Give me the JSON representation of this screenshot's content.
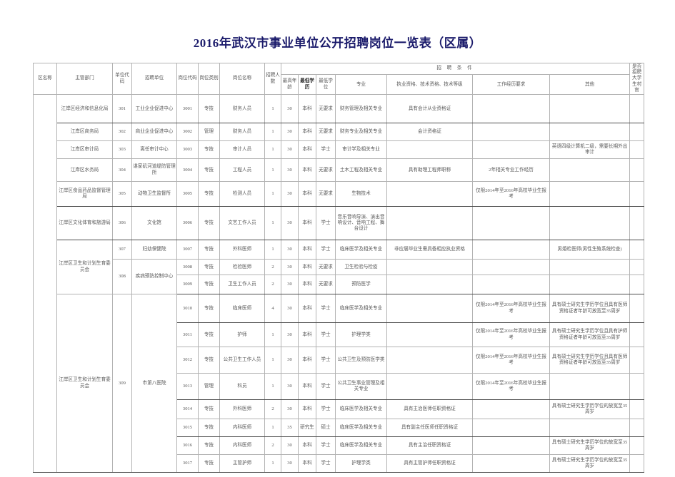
{
  "title": "2016年武汉市事业单位公开招聘岗位一览表（区属）",
  "header": {
    "group_label": "招 聘 条 件",
    "columns": {
      "region": "区名称",
      "dept": "主管部门",
      "unit_code": "单位代码",
      "unit": "招聘单位",
      "post_code": "岗位代码",
      "post_type": "岗位类别",
      "post_name": "岗位名称",
      "headcount": "招聘人数",
      "max_age": "最高年龄",
      "min_edu": "最低学历",
      "min_degree": "最低学位",
      "major": "专业",
      "qualification": "执业资格、技术资格、技术等级",
      "experience": "工作经历要求",
      "other": "其他",
      "village_official": "是否招聘大学生村官"
    }
  },
  "rows": [
    {
      "region": "",
      "dept": "江岸区经济和信息化局",
      "unit_code": "301",
      "unit": "工业企业促进中心",
      "post_code": "3001",
      "post_type": "专技",
      "post_name": "财务人员",
      "headcount": "1",
      "max_age": "30",
      "min_edu": "本科",
      "min_degree": "无要求",
      "major": "财务管理及相关专业",
      "qualification": "具有会计从业资格证",
      "experience": "",
      "other": "",
      "village_official": ""
    },
    {
      "region": "",
      "dept": "江岸区商务局",
      "unit_code": "302",
      "unit": "商业企业促进中心",
      "post_code": "3002",
      "post_type": "管理",
      "post_name": "财务人员",
      "headcount": "1",
      "max_age": "30",
      "min_edu": "本科",
      "min_degree": "无要求",
      "major": "财务专业及相关专业",
      "qualification": "会计资格证",
      "experience": "",
      "other": "",
      "village_official": ""
    },
    {
      "region": "",
      "dept": "江岸区审计局",
      "unit_code": "303",
      "unit": "离任审计中心",
      "post_code": "3003",
      "post_type": "专技",
      "post_name": "审计人员",
      "headcount": "1",
      "max_age": "30",
      "min_edu": "本科",
      "min_degree": "学士",
      "major": "审计学及相关专业",
      "qualification": "",
      "experience": "",
      "other": "英语四级计算机二级，需要长期外出审计",
      "village_official": ""
    },
    {
      "region": "",
      "dept": "江岸区水务局",
      "unit_code": "304",
      "unit": "谌家矶河道堤防管理所",
      "post_code": "3004",
      "post_type": "专技",
      "post_name": "工程人员",
      "headcount": "1",
      "max_age": "30",
      "min_edu": "本科",
      "min_degree": "无要求",
      "major": "土木工程及相关专业",
      "qualification": "具有助理工程师职称",
      "experience": "2年相关专业工作经历",
      "other": "",
      "village_official": ""
    },
    {
      "region": "",
      "dept": "江岸区食品药品监督管理局",
      "unit_code": "305",
      "unit": "动物卫生监督所",
      "post_code": "3005",
      "post_type": "专技",
      "post_name": "检测人员",
      "headcount": "1",
      "max_age": "30",
      "min_edu": "本科",
      "min_degree": "无要求",
      "major": "生物技术",
      "qualification": "",
      "experience": "仅限2014年至2016年高校毕业生报考",
      "other": "",
      "village_official": ""
    },
    {
      "region": "",
      "dept": "江岸区文化体育和旅游局",
      "unit_code": "306",
      "unit": "文化馆",
      "post_code": "3006",
      "post_type": "专技",
      "post_name": "文艺工作人员",
      "headcount": "1",
      "max_age": "30",
      "min_edu": "本科",
      "min_degree": "学士",
      "major": "音乐音响导演、演出音响设计、音响工程、舞台设计",
      "qualification": "",
      "experience": "",
      "other": "",
      "village_official": ""
    },
    {
      "region": "",
      "dept": "江岸区卫生和计划生育委员会",
      "unit_code": "307",
      "unit": "妇幼保健院",
      "post_code": "3007",
      "post_type": "专技",
      "post_name": "外科医师",
      "headcount": "1",
      "max_age": "30",
      "min_edu": "本科",
      "min_degree": "学士",
      "major": "临床医学及相关专业",
      "qualification": "非应届毕业生需具备相应执业资格",
      "experience": "",
      "other": "男婚检医师(男性生殖系统检查)",
      "village_official": ""
    },
    {
      "region": "",
      "dept": "",
      "unit_code": "308",
      "unit": "疾病预防控制中心",
      "post_code": "3008",
      "post_type": "专技",
      "post_name": "检验医师",
      "headcount": "2",
      "max_age": "30",
      "min_edu": "本科",
      "min_degree": "无要求",
      "major": "卫生检验与检疫",
      "qualification": "",
      "experience": "",
      "other": "",
      "village_official": ""
    },
    {
      "region": "",
      "dept": "",
      "unit_code": "",
      "unit": "",
      "post_code": "3009",
      "post_type": "专技",
      "post_name": "卫生工作人员",
      "headcount": "2",
      "max_age": "30",
      "min_edu": "本科",
      "min_degree": "无要求",
      "major": "预防医学",
      "qualification": "",
      "experience": "",
      "other": "",
      "village_official": ""
    },
    {
      "region": "",
      "dept": "江岸区卫生和计划生育委员会",
      "unit_code": "309",
      "unit": "市第八医院",
      "post_code": "3010",
      "post_type": "专技",
      "post_name": "临床医师",
      "headcount": "4",
      "max_age": "30",
      "min_edu": "本科",
      "min_degree": "学士",
      "major": "临床医学及相关专业",
      "qualification": "",
      "experience": "仅限2014年至2016年高校毕业生报考",
      "other": "具有硕士研究生学历学位且具有医师资格证者年龄可放宽至35周岁",
      "village_official": ""
    },
    {
      "region": "",
      "dept": "",
      "unit_code": "",
      "unit": "",
      "post_code": "3011",
      "post_type": "专技",
      "post_name": "护师",
      "headcount": "1",
      "max_age": "30",
      "min_edu": "本科",
      "min_degree": "学士",
      "major": "护理学类",
      "qualification": "",
      "experience": "仅限2014年至2016年高校毕业生报考",
      "other": "具有硕士研究生学历学位且具有护师资格证者年龄可放宽至35周岁",
      "village_official": ""
    },
    {
      "region": "",
      "dept": "",
      "unit_code": "",
      "unit": "",
      "post_code": "3012",
      "post_type": "专技",
      "post_name": "公共卫生工作人员",
      "headcount": "1",
      "max_age": "30",
      "min_edu": "本科",
      "min_degree": "学士",
      "major": "公共卫生及预防医学类",
      "qualification": "",
      "experience": "仅限2014年至2016年高校毕业生报考",
      "other": "具有硕士研究生学历学位且具有医师资格证者年龄可放宽至35周岁",
      "village_official": ""
    },
    {
      "region": "",
      "dept": "",
      "unit_code": "",
      "unit": "",
      "post_code": "3013",
      "post_type": "管理",
      "post_name": "科员",
      "headcount": "1",
      "max_age": "30",
      "min_edu": "本科",
      "min_degree": "学士",
      "major": "公共卫生事业管理及相关专业",
      "qualification": "",
      "experience": "仅限2014年至2016年高校毕业生报考",
      "other": "",
      "village_official": ""
    },
    {
      "region": "",
      "dept": "",
      "unit_code": "",
      "unit": "",
      "post_code": "3014",
      "post_type": "专技",
      "post_name": "外科医师",
      "headcount": "2",
      "max_age": "30",
      "min_edu": "本科",
      "min_degree": "学士",
      "major": "临床医学及相关专业",
      "qualification": "具有主治医师任职资格证",
      "experience": "",
      "other": "具有硕士研究生学历学位的放宽至35周岁",
      "village_official": ""
    },
    {
      "region": "",
      "dept": "",
      "unit_code": "",
      "unit": "",
      "post_code": "3015",
      "post_type": "专技",
      "post_name": "内科医师",
      "headcount": "1",
      "max_age": "35",
      "min_edu": "研究生",
      "min_degree": "硕士",
      "major": "临床医学及相关专业",
      "qualification": "具有副主任医师任职资格证",
      "experience": "",
      "other": "",
      "village_official": ""
    },
    {
      "region": "",
      "dept": "",
      "unit_code": "",
      "unit": "",
      "post_code": "3016",
      "post_type": "专技",
      "post_name": "内科医师",
      "headcount": "2",
      "max_age": "30",
      "min_edu": "本科",
      "min_degree": "学士",
      "major": "临床医学及相关专业",
      "qualification": "具有主治任职资格证",
      "experience": "",
      "other": "具有硕士研究生学历学位的放宽至35周岁",
      "village_official": ""
    },
    {
      "region": "",
      "dept": "",
      "unit_code": "",
      "unit": "",
      "post_code": "3017",
      "post_type": "专技",
      "post_name": "主管护师",
      "headcount": "1",
      "max_age": "30",
      "min_edu": "本科",
      "min_degree": "学士",
      "major": "护理学类",
      "qualification": "具有主管护师任职资格证",
      "experience": "",
      "other": "具有硕士研究生学历学位的放宽至35周岁",
      "village_official": ""
    }
  ]
}
